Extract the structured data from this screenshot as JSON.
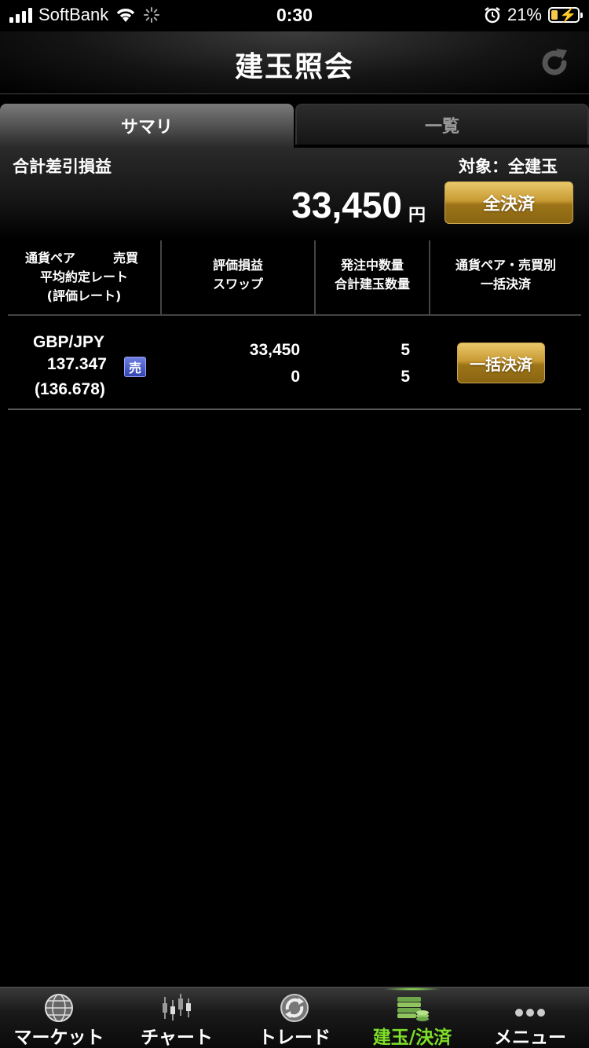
{
  "status_bar": {
    "carrier": "SoftBank",
    "time": "0:30",
    "battery_percent": "21%",
    "battery_level": 0.21
  },
  "header": {
    "title": "建玉照会"
  },
  "tabs": [
    {
      "label": "サマリ",
      "active": true
    },
    {
      "label": "一覧",
      "active": false
    }
  ],
  "summary": {
    "total_label": "合計差引損益",
    "target_label": "対象：全建玉",
    "total_amount": "33,450",
    "total_unit": "円",
    "close_all_label": "全決済"
  },
  "table": {
    "headers": {
      "col1_line1_a": "通貨ペア",
      "col1_line1_b": "売買",
      "col1_line2": "平均約定レート",
      "col1_line3": "(評価レート)",
      "col2_line1": "評価損益",
      "col2_line2": "スワップ",
      "col3_line1": "発注中数量",
      "col3_line2": "合計建玉数量",
      "col4_line1": "通貨ペア・売買別",
      "col4_line2": "一括決済"
    },
    "rows": [
      {
        "pair": "GBP/JPY",
        "avg_rate": "137.347",
        "side": "売",
        "eval_rate": "(136.678)",
        "pl": "33,450",
        "swap": "0",
        "order_qty": "5",
        "total_qty": "5",
        "bulk_close_label": "一括決済"
      }
    ]
  },
  "tabbar": {
    "items": [
      {
        "label": "マーケット",
        "icon": "globe-icon"
      },
      {
        "label": "チャート",
        "icon": "candlestick-icon"
      },
      {
        "label": "トレード",
        "icon": "trade-icon"
      },
      {
        "label": "建玉/決済",
        "icon": "coins-icon",
        "active": true
      },
      {
        "label": "メニュー",
        "icon": "more-icon"
      }
    ]
  },
  "colors": {
    "active_tab_label": "#7ee02a",
    "gold_button": "#c89a33",
    "sell_badge": "#3344b0"
  }
}
